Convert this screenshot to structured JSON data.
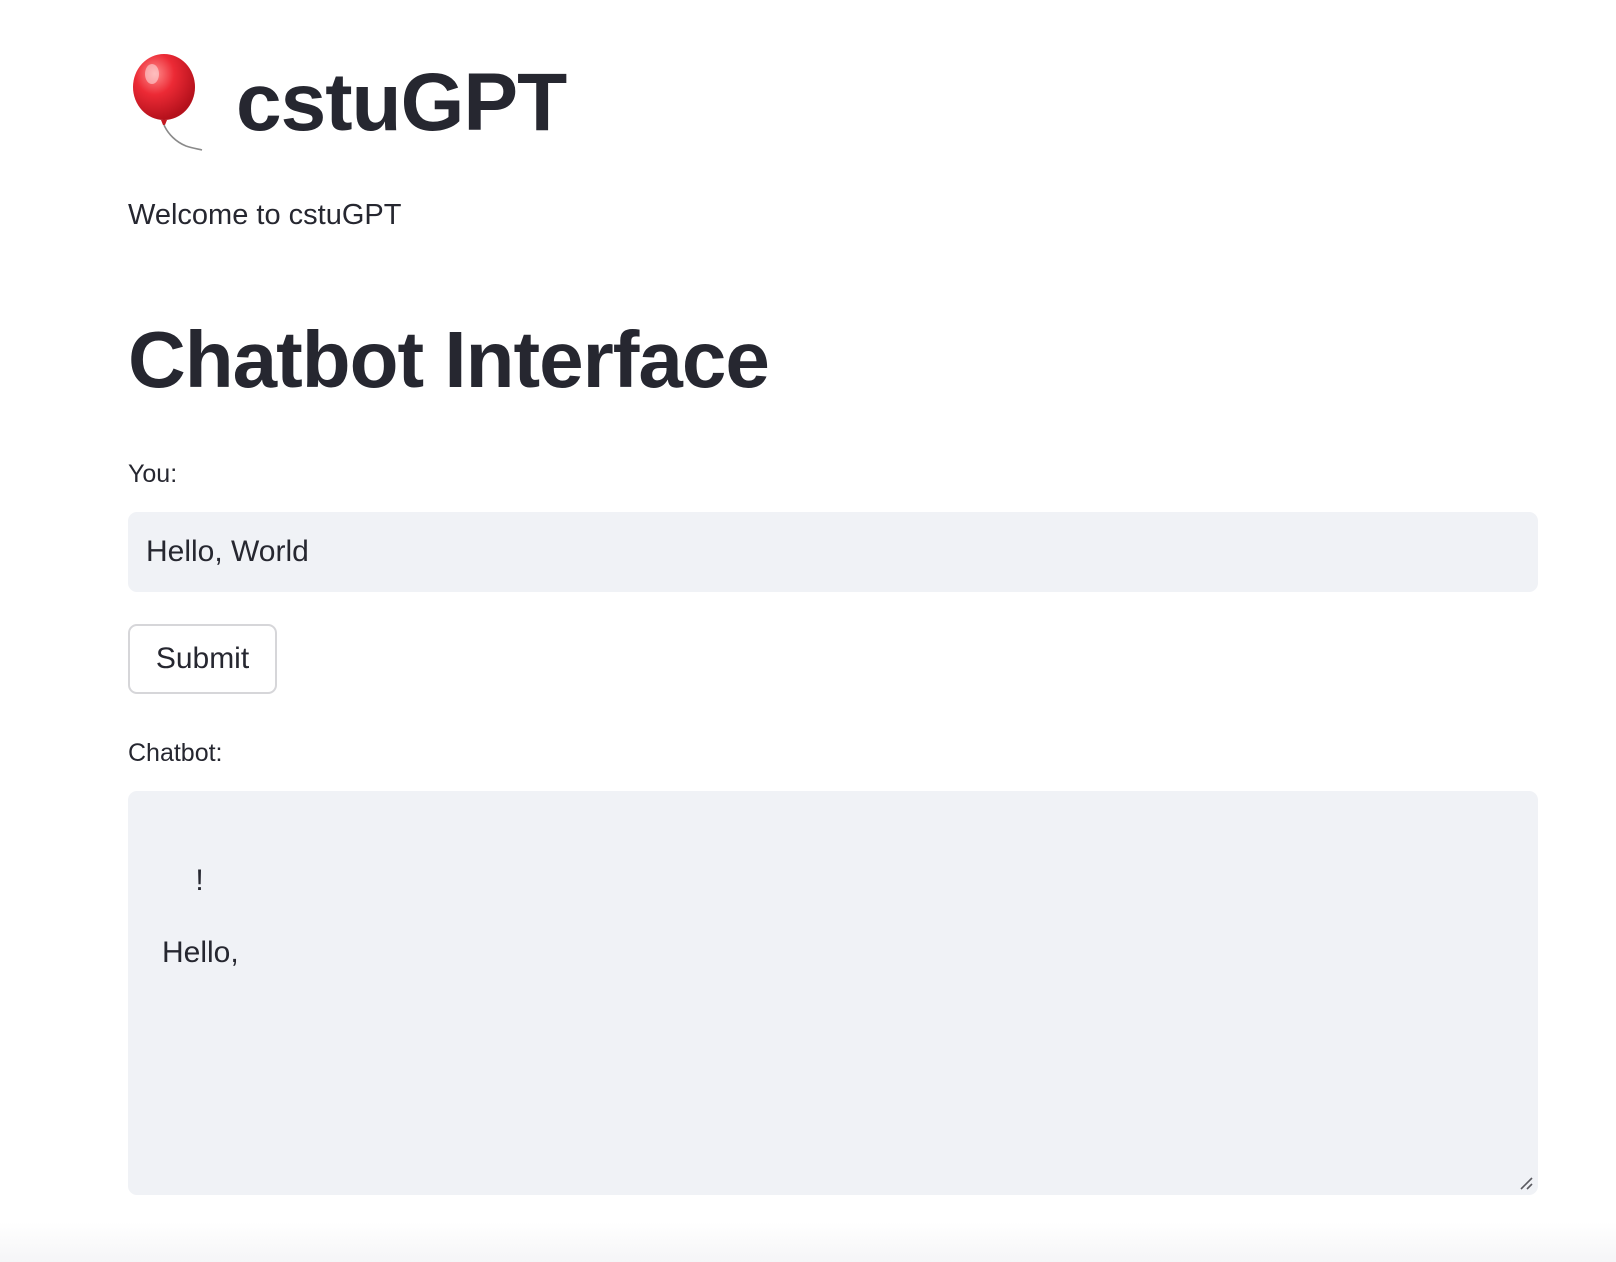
{
  "header": {
    "icon": "balloon-icon",
    "title": "cstuGPT",
    "welcome": "Welcome to cstuGPT"
  },
  "main": {
    "section_title": "Chatbot Interface",
    "input_label": "You:",
    "input_value": "Hello, World",
    "submit_label": "Submit",
    "response_label": "Chatbot:",
    "response_text": "!\n\nHello,"
  },
  "colors": {
    "text": "#262730",
    "field_background": "#f0f2f6",
    "button_border": "#d6d6d9",
    "balloon": "#e8232f"
  }
}
